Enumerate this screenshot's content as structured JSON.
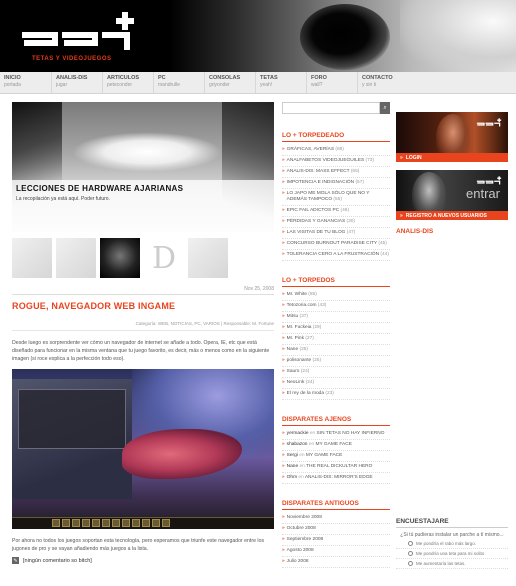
{
  "site": {
    "tagline": "TETAS Y VIDEOJUEGOS",
    "accent": "#e8451e"
  },
  "nav": [
    {
      "label": "INICIO",
      "sub": "portada"
    },
    {
      "label": "ANALIS-DIS",
      "sub": "jugar"
    },
    {
      "label": "ARTICULOS",
      "sub": "peteconder"
    },
    {
      "label": "PC",
      "sub": "mandrulle"
    },
    {
      "label": "CONSOLAS",
      "sub": "griyonder"
    },
    {
      "label": "TETAS",
      "sub": "yeah!"
    },
    {
      "label": "FORO",
      "sub": "wall?"
    },
    {
      "label": "CONTACTO",
      "sub": "y sin ti"
    }
  ],
  "feature": {
    "title": "LECCIONES DE HARDWARE AJARIANAS",
    "subtitle": "La recopilación ya está aquí. Poder futuro."
  },
  "post": {
    "date": "Nov 25, 2008",
    "title": "ROGUE, NAVEGADOR WEB INGAME",
    "categories": "Categoría: WEB, NOTICIAS, PC, VARIOS | Responsable: M. Fortune",
    "intro": "Desde luego es sorprendente ver cómo un navegador de internet se añade a todo. Opera, IE, etc que está diseñado para funcionar en la misma ventana que tu juego favorito, es decir, más o menos como en la siguiente imagen (si roce explica a la perfección todo eso).",
    "outro": "Por ahora no todos los juegos soportan esta tecnología, pero esperamos que triunfe este navegador entre los jugones de pro y se vayan añadiendo más juegos a la lista.",
    "comments": "[ningún comentario so bitch]"
  },
  "sidebar": {
    "search_icon": "search-icon",
    "torpedeado": {
      "title": "LO + TORPEDEADO",
      "items": [
        {
          "text": "GRÁFICAS, AVERÍAS",
          "count": "(88)"
        },
        {
          "text": "ANALFABETOS VIDEOJUEGUILES",
          "count": "(73)"
        },
        {
          "text": "ANALIS-DIS: MASS EFFECT",
          "count": "(65)"
        },
        {
          "text": "IMPOTENCIA E INDIGNACIÓN",
          "count": "(57)"
        },
        {
          "text": "LO JAPO ME MOLA SÓLO QUE NO Y ADEMÁS TAMPOCO",
          "count": "(55)"
        },
        {
          "text": "EPIC FAIL ADICTOS PC",
          "count": "(46)"
        },
        {
          "text": "PÉRDIDAS Y GANANCIAS",
          "count": "(30)"
        },
        {
          "text": "LAS VISITAS DE TU BLOG",
          "count": "(47)"
        },
        {
          "text": "CONCURSO BURNOUT PARADISE CITY",
          "count": "(45)"
        },
        {
          "text": "TOLERANCIA CERO A LA FRUSTRACIÓN",
          "count": "(44)"
        }
      ]
    },
    "torpedos": {
      "title": "LO + TORPEDOS",
      "items": [
        {
          "text": "Mr. White",
          "count": "(85)"
        },
        {
          "text": "Tetozoria.com",
          "count": "(43)"
        },
        {
          "text": "Mitsu",
          "count": "(37)"
        },
        {
          "text": "Mr. Fuckeia",
          "count": "(29)"
        },
        {
          "text": "Mr. Pink",
          "count": "(27)"
        },
        {
          "text": "Nane",
          "count": "(25)"
        },
        {
          "text": "polisonante",
          "count": "(25)"
        },
        {
          "text": "Sauro",
          "count": "(24)"
        },
        {
          "text": "NeoLink",
          "count": "(24)"
        },
        {
          "text": "El rey de la moda",
          "count": "(23)"
        }
      ]
    },
    "ajenos": {
      "title": "DISPARATES AJENOS",
      "items": [
        {
          "author": "yermackie",
          "on": "en",
          "text": "SIN TETAS NO HAY INFIERNO"
        },
        {
          "author": "shabazon",
          "on": "en",
          "text": "MY GAME FACE"
        },
        {
          "author": "Sergi",
          "on": "en",
          "text": "MY GAME FACE"
        },
        {
          "author": "Nane",
          "on": "en",
          "text": "THE REAL DICKULTAR HERO"
        },
        {
          "author": "Ohm",
          "on": "en",
          "text": "ANALIS-DIS: MIRROR'S EDGE"
        }
      ]
    },
    "antiguos": {
      "title": "DISPARATES ANTIGUOS",
      "items": [
        "Noviembre 2008",
        "Octubre 2008",
        "Septiembre 2008",
        "Agosto 2008",
        "Julio 2008"
      ]
    }
  },
  "right": {
    "ad_login": "LOGIN",
    "ad_register_word": "entrar",
    "ad_register": "REGISTRO A NUEVOS USUARIOS",
    "analis_title": "ANALIS-DIS",
    "poll": {
      "title": "ENCUESTAJARE",
      "question": "¿Si tú pudieras instalar un parche a tí mismo...",
      "options": [
        "Me pondría el rabo más largo.",
        "Me pondría una teta para mi solito",
        "Me aumentaría las tetas."
      ]
    }
  }
}
